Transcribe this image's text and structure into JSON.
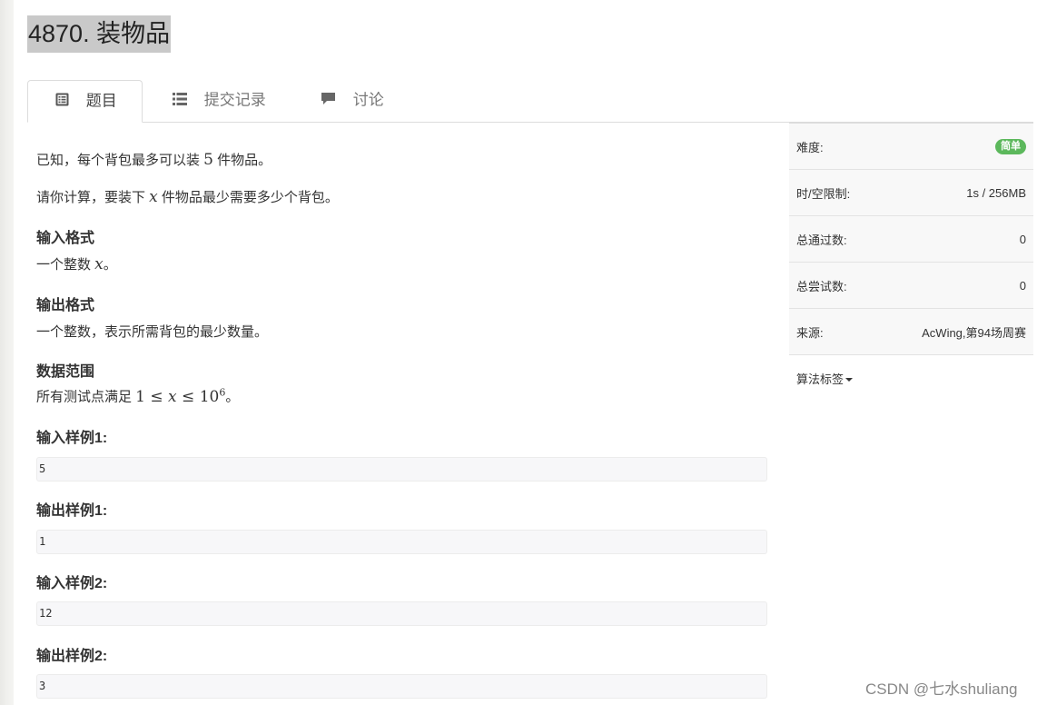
{
  "problem": {
    "title": "4870. 装物品"
  },
  "tabs": [
    {
      "label": "题目",
      "icon": "list-alt-icon"
    },
    {
      "label": "提交记录",
      "icon": "list-icon"
    },
    {
      "label": "讨论",
      "icon": "comment-icon"
    }
  ],
  "content": {
    "intro_pre": "已知，每个背包最多可以装 ",
    "intro_num": "5",
    "intro_post": " 件物品。",
    "ask_pre": "请你计算，要装下 ",
    "ask_var": "x",
    "ask_post": " 件物品最少需要多少个背包。",
    "input_heading": "输入格式",
    "input_pre": "一个整数 ",
    "input_var": "x",
    "input_post": "。",
    "output_heading": "输出格式",
    "output_text": "一个整数，表示所需背包的最少数量。",
    "range_heading": "数据范围",
    "range_pre": "所有测试点满足 ",
    "range_math_a": "1 ≤ ",
    "range_math_var": "x",
    "range_math_b": " ≤ 10",
    "range_math_exp": "6",
    "range_post": "。",
    "samples": [
      {
        "label": "输入样例1:",
        "value": "5"
      },
      {
        "label": "输出样例1:",
        "value": "1"
      },
      {
        "label": "输入样例2:",
        "value": "12"
      },
      {
        "label": "输出样例2:",
        "value": "3"
      }
    ]
  },
  "sidebar": {
    "difficulty_label": "难度:",
    "difficulty_value": "简单",
    "limit_label": "时/空限制:",
    "limit_value": "1s / 256MB",
    "passed_label": "总通过数:",
    "passed_value": "0",
    "tried_label": "总尝试数:",
    "tried_value": "0",
    "source_label": "来源:",
    "source_value": "AcWing,第94场周赛",
    "tags_label": "算法标签"
  },
  "watermark": "CSDN @七水shuliang",
  "colors": {
    "badge_green": "#5cb85c",
    "title_highlight": "#c9c9c9"
  }
}
